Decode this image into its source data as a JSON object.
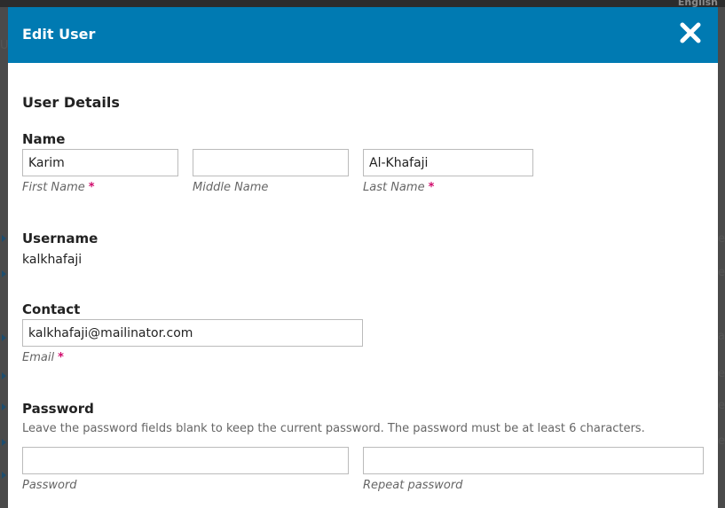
{
  "background": {
    "language_link": "English",
    "peek_text": [
      "Us",
      "e",
      "e",
      "sa",
      "e",
      "ve",
      "e"
    ]
  },
  "modal": {
    "title": "Edit User",
    "close_icon": "close-icon"
  },
  "form": {
    "section_title": "User Details",
    "name": {
      "label": "Name",
      "first_name": {
        "value": "Karim",
        "caption": "First Name",
        "required_mark": "*"
      },
      "middle_name": {
        "value": "",
        "caption": "Middle Name"
      },
      "last_name": {
        "value": "Al-Khafaji",
        "caption": "Last Name",
        "required_mark": "*"
      }
    },
    "username": {
      "label": "Username",
      "value": "kalkhafaji"
    },
    "contact": {
      "label": "Contact",
      "email": {
        "value": "kalkhafaji@mailinator.com",
        "caption": "Email",
        "required_mark": "*"
      }
    },
    "password": {
      "label": "Password",
      "help": "Leave the password fields blank to keep the current password. The password must be at least 6 characters.",
      "password": {
        "value": "",
        "caption": "Password"
      },
      "repeat": {
        "value": "",
        "caption": "Repeat password"
      }
    }
  },
  "colors": {
    "header": "#007ab2",
    "required": "#d00a6c"
  }
}
